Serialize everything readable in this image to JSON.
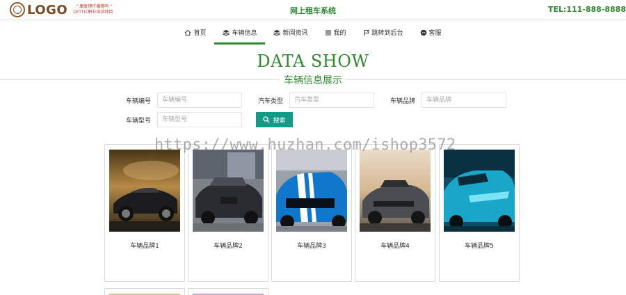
{
  "header": {
    "logo_text": "LOGO",
    "logo_slogan_line1": "“ 康复理疗播睿吗 ”",
    "logo_slogan_line2": "CETTIC职业培训项目",
    "site_title": "网上租车系统",
    "phone": "TEL:111-888-8888"
  },
  "nav": {
    "items": [
      {
        "label": "首页",
        "icon": "home-icon",
        "active": false
      },
      {
        "label": "车辆信息",
        "icon": "stack-icon",
        "active": true
      },
      {
        "label": "新闻资讯",
        "icon": "stack-icon",
        "active": false
      },
      {
        "label": "我的",
        "icon": "list-icon",
        "active": false
      },
      {
        "label": "跳转到后台",
        "icon": "flag-icon",
        "active": false
      },
      {
        "label": "客服",
        "icon": "chat-icon",
        "active": false
      }
    ]
  },
  "section": {
    "title": "DATA SHOW",
    "subtitle": "车辆信息展示"
  },
  "search": {
    "fields": [
      {
        "label": "车辆编号",
        "value": "",
        "placeholder": "车辆编号"
      },
      {
        "label": "汽车类型",
        "value": "",
        "placeholder": "汽车类型"
      },
      {
        "label": "车辆品牌",
        "value": "",
        "placeholder": "车辆品牌"
      },
      {
        "label": "车辆型号",
        "value": "",
        "placeholder": "车辆型号"
      }
    ],
    "button_label": "搜索"
  },
  "cards": [
    {
      "label": "车辆品牌1"
    },
    {
      "label": "车辆品牌2"
    },
    {
      "label": "车辆品牌3"
    },
    {
      "label": "车辆品牌4"
    },
    {
      "label": "车辆品牌5"
    }
  ],
  "watermark": "https://www.huzhan.com/ishop3572",
  "colors": {
    "accent": "#2e8b2e",
    "button": "#139a88",
    "logo_brown": "#7a4a22",
    "slogan_red": "#c0382b"
  }
}
